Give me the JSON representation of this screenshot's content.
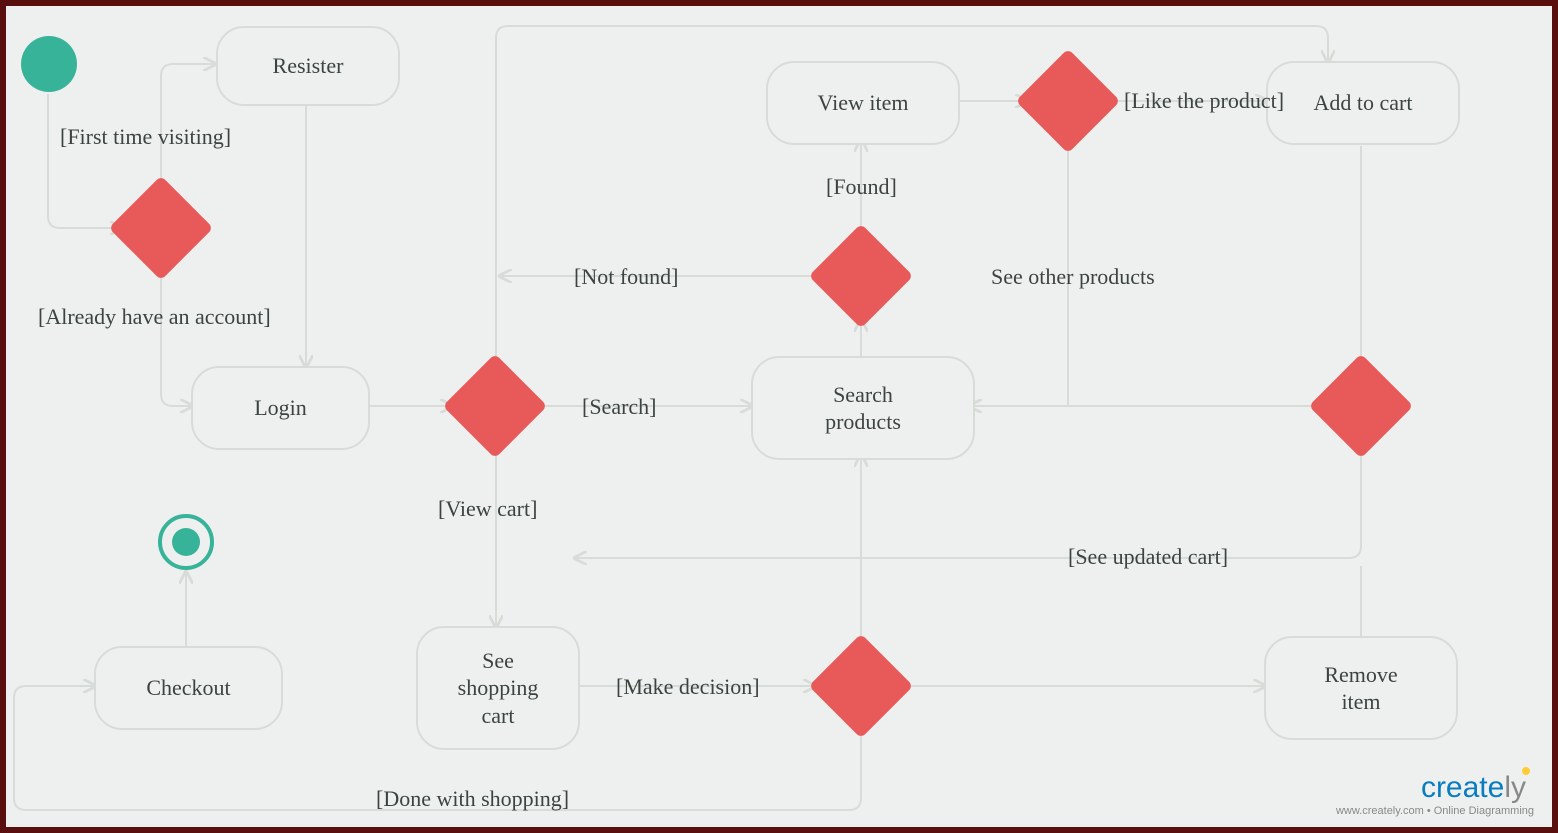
{
  "nodes": {
    "register": "Resister",
    "login": "Login",
    "view_item": "View item",
    "add_to_cart": "Add to cart",
    "search_products": "Search\nproducts",
    "see_cart": "See\nshopping\ncart",
    "checkout": "Checkout",
    "remove_item": "Remove\nitem"
  },
  "edges": {
    "first_time": "[First time visiting]",
    "already_have": "[Already have an account]",
    "view_cart": "[View cart]",
    "search": "[Search]",
    "not_found": "[Not found]",
    "found": "[Found]",
    "like_product": "[Like the product]",
    "see_other": "See other products",
    "see_updated_cart": "[See updated cart]",
    "make_decision": "[Make decision]",
    "done_shopping": "[Done with shopping]"
  },
  "watermark": {
    "brand_create": "create",
    "brand_ly": "ly",
    "tagline": "www.creately.com • Online Diagramming"
  }
}
